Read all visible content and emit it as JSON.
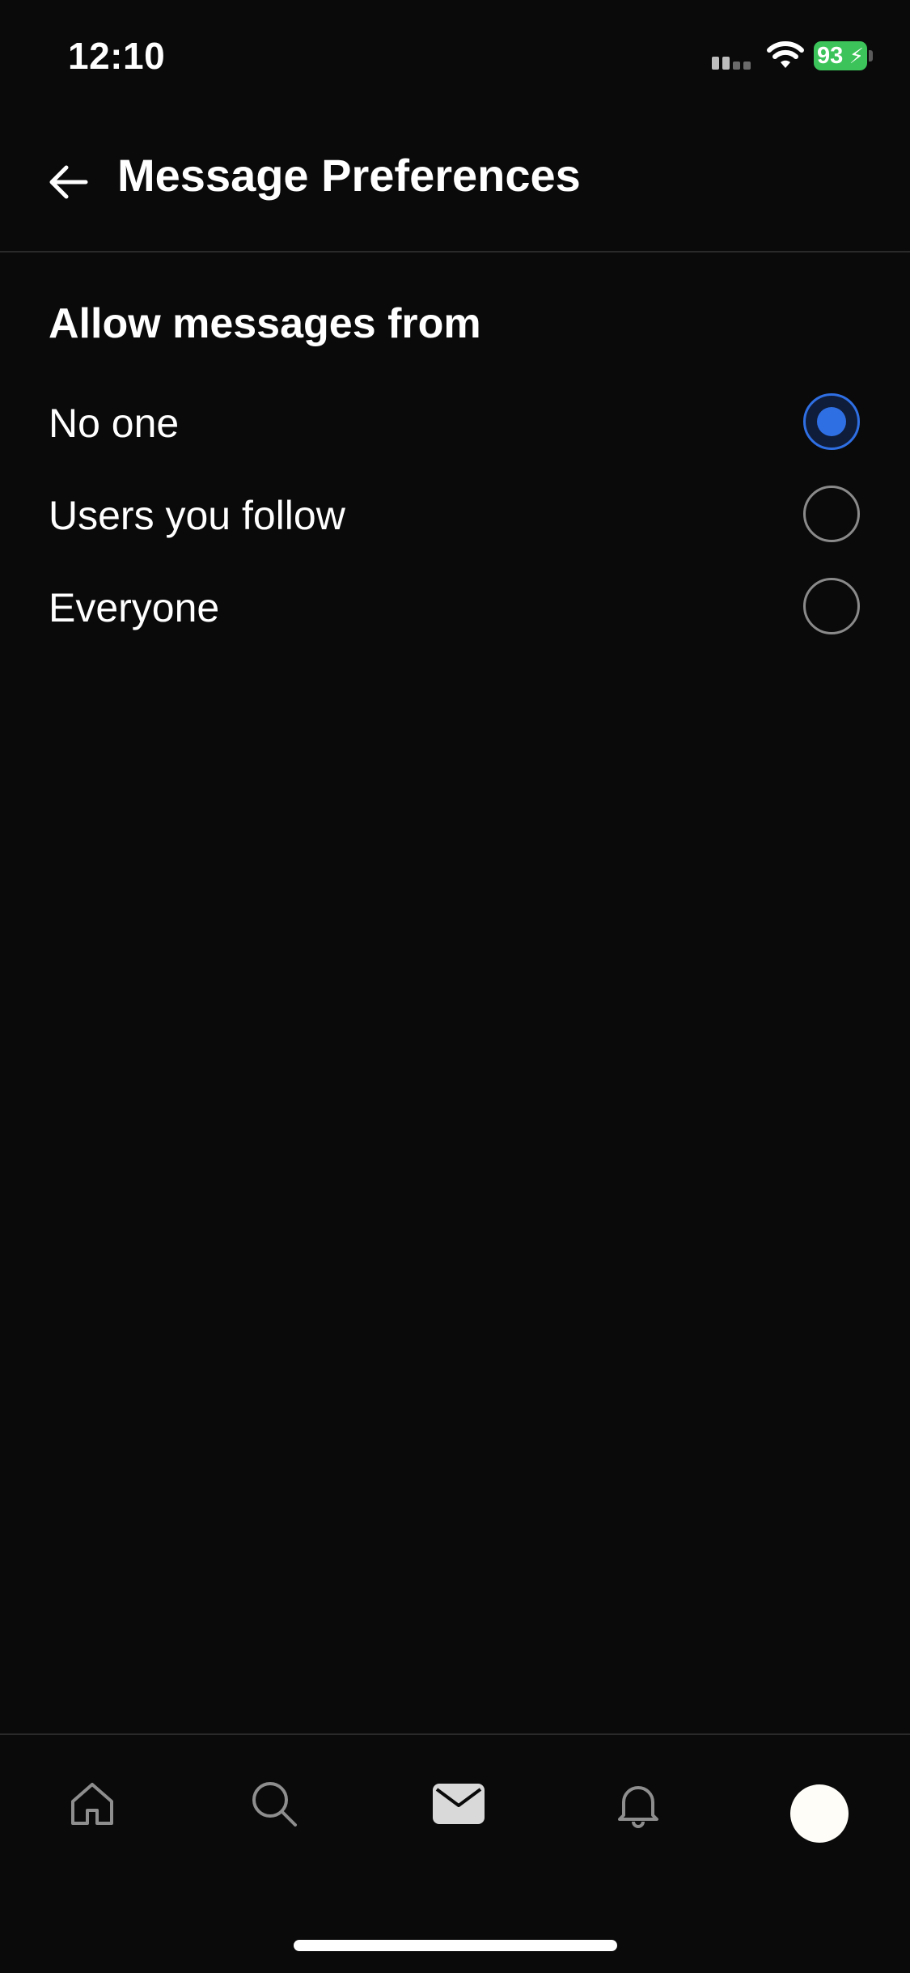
{
  "status_bar": {
    "time": "12:10",
    "battery_level": "93",
    "battery_color": "#3cc45a"
  },
  "header": {
    "title": "Message Preferences",
    "back_icon": "arrow-left-icon"
  },
  "section": {
    "title": "Allow messages from",
    "options": [
      {
        "label": "No one",
        "selected": true
      },
      {
        "label": "Users you follow",
        "selected": false
      },
      {
        "label": "Everyone",
        "selected": false
      }
    ]
  },
  "tab_bar": {
    "tabs": [
      {
        "name": "home",
        "icon": "home-icon",
        "active": false
      },
      {
        "name": "search",
        "icon": "search-icon",
        "active": false
      },
      {
        "name": "messages",
        "icon": "envelope-icon",
        "active": true
      },
      {
        "name": "notifications",
        "icon": "bell-icon",
        "active": false
      },
      {
        "name": "profile",
        "icon": "avatar",
        "active": false
      }
    ]
  },
  "colors": {
    "background": "#0a0a0a",
    "accent": "#2f6fe4",
    "text": "#ffffff",
    "divider": "#2a2a2a"
  }
}
